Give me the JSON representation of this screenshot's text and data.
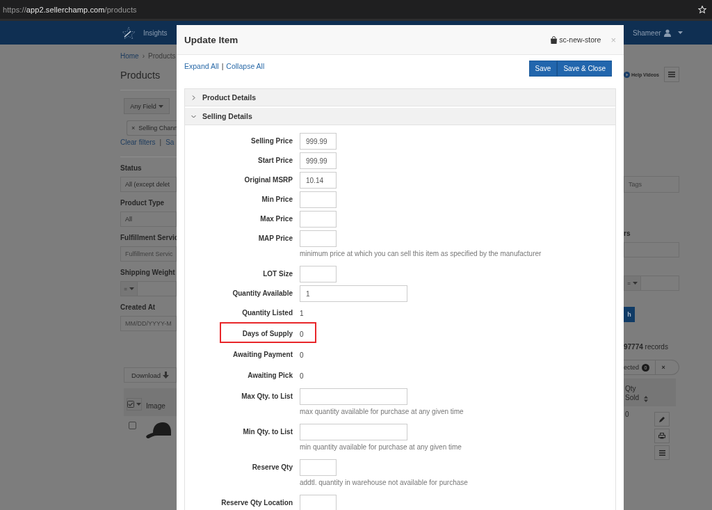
{
  "browser": {
    "url_scheme": "https://",
    "url_host": "app2.sellerchamp.com",
    "url_path": "/products"
  },
  "nav": {
    "items": [
      "Insights"
    ],
    "user": "Shameer"
  },
  "page": {
    "breadcrumb": [
      "Home",
      "Products"
    ],
    "breadcrumb_separator": "›",
    "title": "Products",
    "help_videos": "Help Videos",
    "search_scope": "Any Field",
    "filter_chip": "Selling Chann",
    "chip_remove": "×",
    "clear_filters": "Clear filters",
    "filter_links_separator": "|",
    "save_link": "Sa",
    "filters": [
      {
        "label": "Status",
        "kind": "select",
        "value": "All (except delet"
      },
      {
        "label": "Product Type",
        "kind": "select",
        "value": "All"
      },
      {
        "label": "Fulfillment Servic",
        "kind": "text",
        "placeholder": "Fulfillment Servic"
      },
      {
        "label": "Shipping Weight",
        "kind": "operator",
        "operator": "="
      },
      {
        "label": "Created At",
        "kind": "text",
        "placeholder": "MM/DD/YYYY-M"
      }
    ],
    "filters_right": [
      {
        "kind": "text",
        "placeholder": "Tags"
      },
      {
        "label": "rs",
        "kind": "text"
      },
      {
        "kind": "operator",
        "operator": "="
      }
    ],
    "search_button": "h",
    "record_count": "97774",
    "record_label": "records",
    "selected_label": "ected",
    "selected_count": "0",
    "clear_selection": "×",
    "download_button": "Download",
    "table": {
      "columns": [
        "Image",
        "Qty Sold"
      ],
      "rows": [
        {
          "checked": false,
          "qty_sold": "0"
        }
      ]
    }
  },
  "modal": {
    "title": "Update Item",
    "store": "sc-new-store",
    "close": "×",
    "links": [
      "Expand All",
      "Collapse All"
    ],
    "links_separator": "|",
    "buttons": [
      "Save",
      "Save & Close"
    ],
    "sections": [
      {
        "title": "Product Details",
        "expanded": false
      },
      {
        "title": "Selling Details",
        "expanded": true,
        "fields": [
          {
            "label": "Selling Price",
            "kind": "short_input",
            "value": "999.99",
            "highlighted": false
          },
          {
            "label": "Start Price",
            "kind": "short_input",
            "value": "999.99",
            "highlighted": false
          },
          {
            "label": "Original MSRP",
            "kind": "short_input",
            "value": "10.14",
            "highlighted": false
          },
          {
            "label": "Min Price",
            "kind": "short_input",
            "highlighted": false
          },
          {
            "label": "Max Price",
            "kind": "short_input",
            "highlighted": false
          },
          {
            "label": "MAP Price",
            "kind": "short_input",
            "help": "minimum price at which you can sell this item as specified by the manufacturer",
            "highlighted": false
          },
          {
            "label": "LOT Size",
            "kind": "short_input",
            "highlighted": false
          },
          {
            "label": "Quantity Available",
            "kind": "wide_input",
            "value": "1",
            "highlighted": false
          },
          {
            "label": "Quantity Listed",
            "kind": "text",
            "value": "1",
            "highlighted": false
          },
          {
            "label": "Days of Supply",
            "kind": "text",
            "value": "0",
            "highlighted": true
          },
          {
            "label": "Awaiting Payment",
            "kind": "text",
            "value": "0",
            "highlighted": false
          },
          {
            "label": "Awaiting Pick",
            "kind": "text",
            "value": "0",
            "highlighted": false
          },
          {
            "label": "Max Qty. to List",
            "kind": "wide_input",
            "help": "max quantity available for purchase at any given time",
            "highlighted": false
          },
          {
            "label": "Min Qty. to List",
            "kind": "wide_input",
            "help": "min quantity available for purchase at any given time",
            "highlighted": false
          },
          {
            "label": "Reserve Qty",
            "kind": "short_input",
            "help": "addtl. quantity in warehouse not available for purchase",
            "highlighted": false
          },
          {
            "label": "Reserve Qty Location",
            "kind": "short_input",
            "highlighted": false
          }
        ]
      }
    ]
  }
}
